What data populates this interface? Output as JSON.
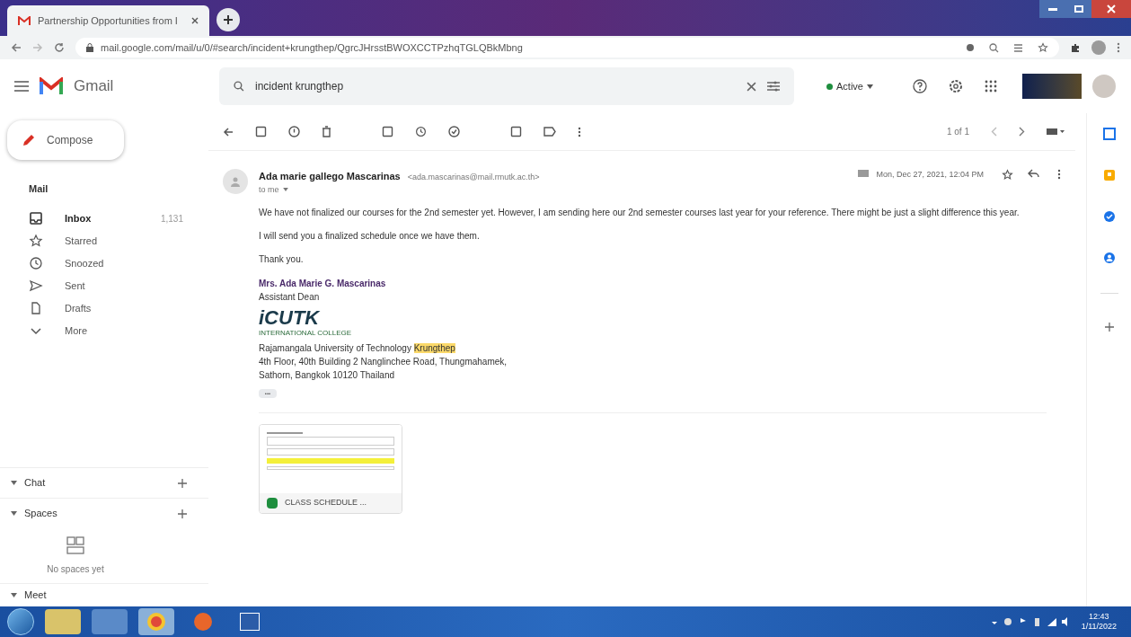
{
  "browser": {
    "tab_title": "Partnership Opportunities from I",
    "url": "mail.google.com/mail/u/0/#search/incident+krungthep/QgrcJHrsstBWOXCCTPzhqTGLQBkMbng"
  },
  "header": {
    "app_name": "Gmail",
    "search_value": "incident krungthep",
    "status": "Active"
  },
  "sidebar": {
    "compose": "Compose",
    "mail_heading": "Mail",
    "items": [
      {
        "label": "Inbox",
        "count": "1,131",
        "selected": true,
        "kind": "inbox"
      },
      {
        "label": "Starred",
        "selected": false,
        "kind": "star"
      },
      {
        "label": "Snoozed",
        "selected": false,
        "kind": "clock"
      },
      {
        "label": "Sent",
        "selected": false,
        "kind": "send"
      },
      {
        "label": "Drafts",
        "selected": false,
        "kind": "file"
      },
      {
        "label": "More",
        "selected": false,
        "kind": "chevron"
      }
    ],
    "sections": [
      {
        "label": "Chat"
      },
      {
        "label": "Spaces"
      }
    ],
    "spaces_empty": "No spaces yet",
    "meet": "Meet"
  },
  "toolbar": {
    "pagination": "1 of 1"
  },
  "message": {
    "sender": "Ada marie gallego Mascarinas",
    "sender_email": "<ada.mascarinas@mail.rmutk.ac.th>",
    "recipient": "to me",
    "date": "Mon, Dec 27, 2021, 12:04 PM",
    "paragraphs": [
      "We have not finalized our courses for the 2nd semester yet. However, I am sending here our 2nd semester courses last year for your reference. There might be just a slight difference this year.",
      "I will send you a finalized schedule once we have them.",
      "Thank you."
    ],
    "signature_name": "Mrs. Ada Marie G. Mascarinas",
    "signature_title": "Assistant Dean",
    "logo_text": "iCUTK",
    "logo_subtext": "INTERNATIONAL COLLEGE",
    "address_lines": [
      "Rajamangala University of Technology **Krungthep**",
      "4th Floor, 40th Building 2 Nanglinchee Road, Thungmahamek,",
      "Sathorn, Bangkok 10120 Thailand"
    ],
    "ellipsis": "•••",
    "attachment": {
      "name": "CLASS SCHEDULE ..."
    }
  },
  "taskbar": {
    "time": "12:43",
    "date": "1/11/2022"
  }
}
